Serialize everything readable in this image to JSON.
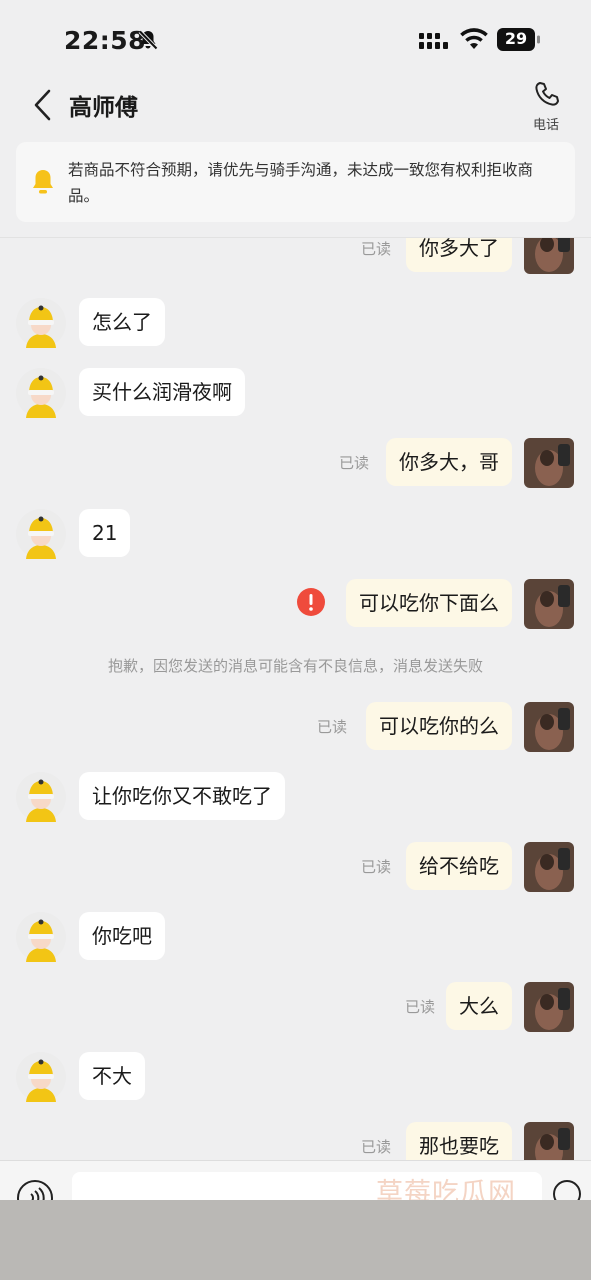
{
  "status_bar": {
    "time": "22:58",
    "battery": "29"
  },
  "header": {
    "contact_name": "高师傅",
    "phone_label": "电话"
  },
  "notice": {
    "text": "若商品不符合预期，请优先与骑手沟通，未达成一致您有权利拒收商品。"
  },
  "messages": [
    {
      "side": "out",
      "text": "你多大了",
      "status": "已读"
    },
    {
      "side": "in",
      "text": "怎么了"
    },
    {
      "side": "in",
      "text": "买什么润滑夜啊"
    },
    {
      "side": "out",
      "text": "你多大，哥",
      "status": "已读"
    },
    {
      "side": "in",
      "text": "21"
    },
    {
      "side": "out",
      "text": "可以吃你下面么",
      "failed": true
    },
    {
      "side": "system",
      "text": "抱歉，因您发送的消息可能含有不良信息，消息发送失败"
    },
    {
      "side": "out",
      "text": "可以吃你的么",
      "status": "已读"
    },
    {
      "side": "in",
      "text": "让你吃你又不敢吃了"
    },
    {
      "side": "out",
      "text": "给不给吃",
      "status": "已读"
    },
    {
      "side": "in",
      "text": "你吃吧"
    },
    {
      "side": "out",
      "text": "大么",
      "status": "已读"
    },
    {
      "side": "in",
      "text": "不大"
    },
    {
      "side": "out",
      "text": "那也要吃",
      "status": "已读"
    }
  ],
  "watermark": "草莓吃瓜网",
  "colors": {
    "background": "#efeff0",
    "incoming_bubble": "#ffffff",
    "outgoing_bubble": "#fdf8e6",
    "notice_bell": "#f6c21a",
    "error_badge": "#ef4b3c",
    "read_text": "#999999"
  },
  "icons": {
    "back": "chevron-left-icon",
    "phone": "phone-icon",
    "notice": "bell-icon",
    "mute": "bell-off-icon",
    "fail": "exclamation-icon",
    "voice": "voice-icon"
  }
}
